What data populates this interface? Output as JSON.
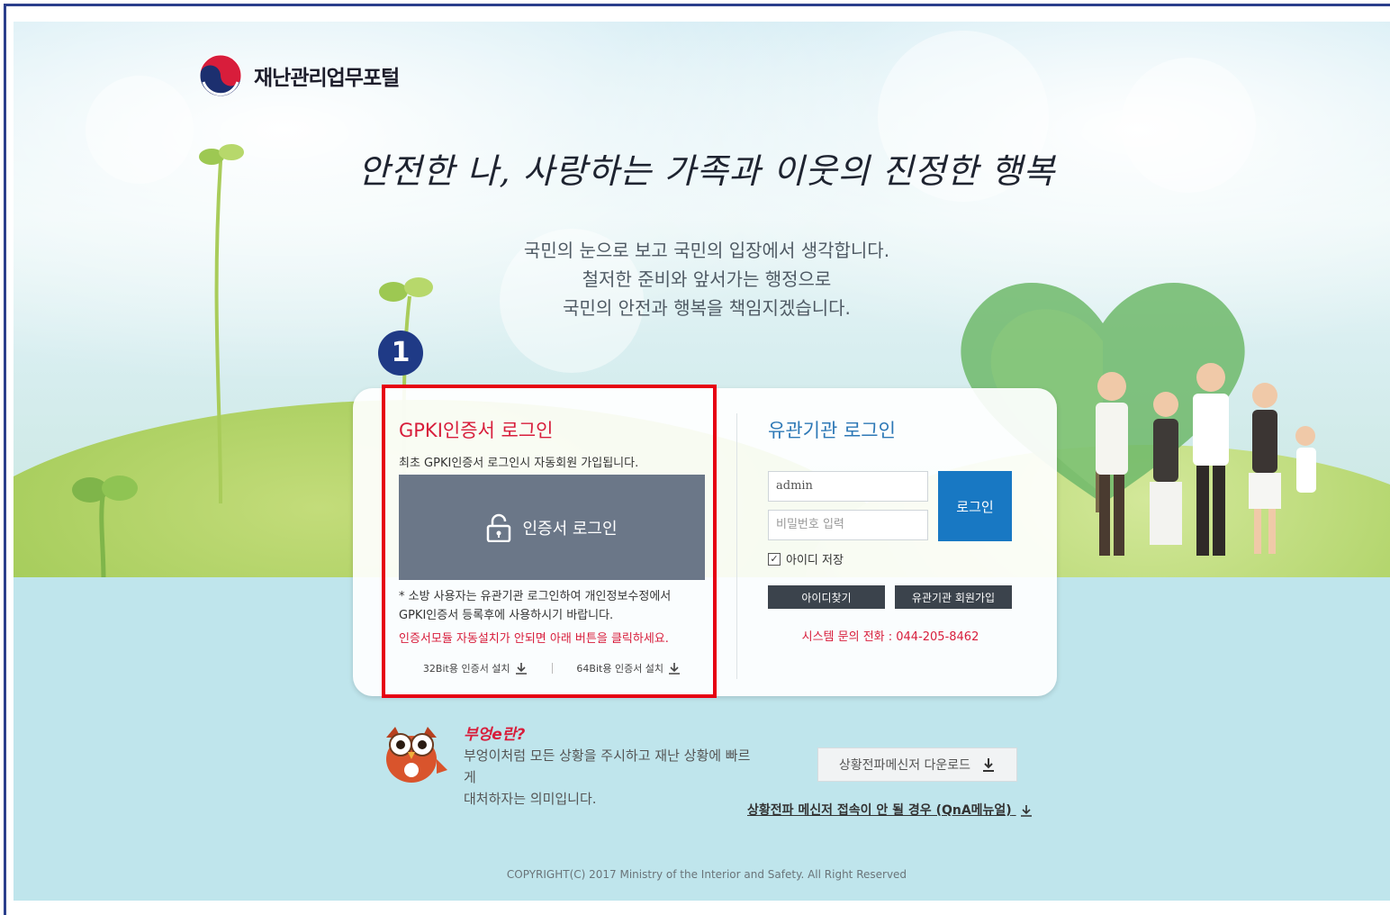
{
  "header": {
    "logo_text": "재난관리업무포털"
  },
  "hero": {
    "headline": "안전한 나, 사랑하는 가족과 이웃의 진정한 행복",
    "subtext": [
      "국민의 눈으로 보고 국민의 입장에서 생각합니다.",
      "철저한 준비와 앞서가는 행정으로",
      "국민의 안전과 행복을 책임지겠습니다."
    ]
  },
  "annotation": {
    "step": "1",
    "highlight_color": "#e60012"
  },
  "gpki": {
    "title": "GPKI인증서 로그인",
    "note": "최초 GPKI인증서 로그인시 자동회원 가입됩니다.",
    "button_label": "인증서 로그인",
    "fire_note_line1": "* 소방 사용자는 유관기관 로그인하여 개인정보수정에서",
    "fire_note_line2": "GPKI인증서 등록후에 사용하시기 바랍니다.",
    "install_note": "인증서모듈 자동설치가 안되면 아래 버튼을 클릭하세요.",
    "download_32": "32Bit용 인증서 설치",
    "download_64": "64Bit용 인증서 설치"
  },
  "org_login": {
    "title": "유관기관 로그인",
    "id_value": "admin",
    "pw_placeholder": "비밀번호 입력",
    "login_button": "로그인",
    "save_id_label": "아이디 저장",
    "save_id_checked": true,
    "find_id_button": "아이디찾기",
    "signup_button": "유관기관 회원가입",
    "phone": "시스템 문의 전화 : 044-205-8462"
  },
  "owl": {
    "title": "부엉e란?",
    "desc_line1": "부엉이처럼 모든 상황을 주시하고 재난 상황에 빠르게",
    "desc_line2": "대처하자는 의미입니다."
  },
  "messenger": {
    "download_button": "상황전파메신저 다운로드",
    "qna_link": "상황전파 메신저 접속이 안 될 경우 (QnA메뉴얼)"
  },
  "footer": {
    "copyright": "COPYRIGHT(C) 2017 Ministry of the Interior and Safety. All Right Reserved"
  },
  "colors": {
    "accent_blue": "#1878c3",
    "accent_red": "#d81d3b",
    "badge": "#1f3a86",
    "cert_button": "#6b7788"
  }
}
